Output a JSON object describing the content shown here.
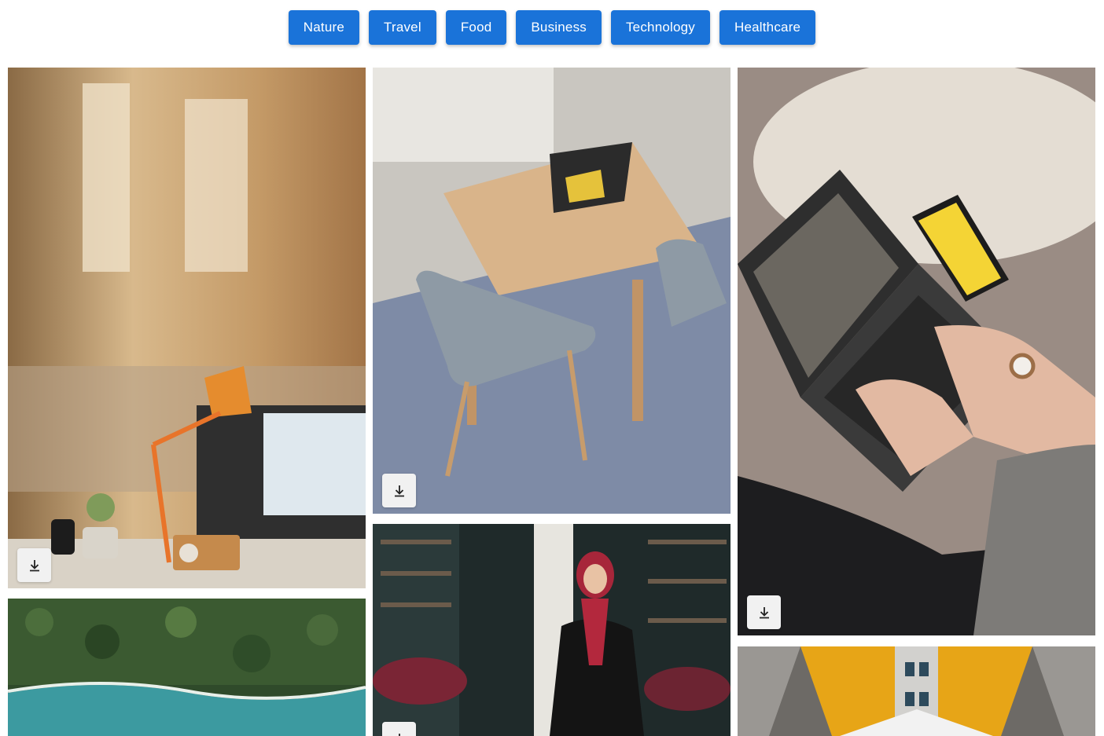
{
  "filters": [
    {
      "label": "Nature"
    },
    {
      "label": "Travel"
    },
    {
      "label": "Food"
    },
    {
      "label": "Business"
    },
    {
      "label": "Technology"
    },
    {
      "label": "Healthcare"
    }
  ],
  "photos": [
    {
      "subject": "office-desk-with-lamp-and-monitor",
      "has_download": true
    },
    {
      "subject": "aerial-forest-and-coastline",
      "has_download": false
    },
    {
      "subject": "wooden-table-with-tablet-and-chairs",
      "has_download": true
    },
    {
      "subject": "woman-in-hijab-in-shop",
      "has_download": true
    },
    {
      "subject": "laptop-on-fur-rug-with-phone",
      "has_download": true
    },
    {
      "subject": "yellow-architecture-from-below",
      "has_download": false
    }
  ],
  "icons": {
    "download": "download-icon"
  },
  "colors": {
    "filter_button": "#1a73d9",
    "filter_text": "#ffffff",
    "download_button": "#f1f1f1"
  }
}
